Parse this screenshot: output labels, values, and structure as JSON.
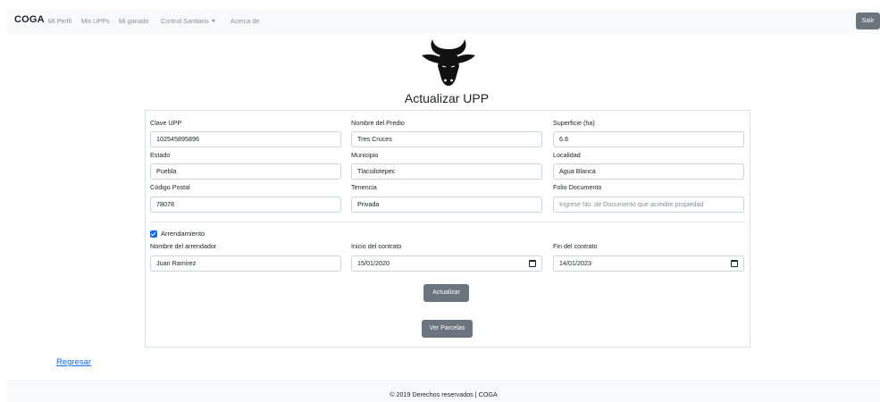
{
  "navbar": {
    "brand": "COGA",
    "links": [
      "Mi Perfil",
      "Mis UPPs",
      "Mi ganado",
      "Control Sanitario",
      "Acerca de"
    ],
    "logout_label": "Salir"
  },
  "page": {
    "title": "Actualizar UPP"
  },
  "form": {
    "clave_upp": {
      "label": "Clave UPP",
      "value": "102545895896"
    },
    "nombre_predio": {
      "label": "Nombre del Predio",
      "value": "Tres Cruces"
    },
    "superficie": {
      "label": "Superficie (ha)",
      "value": "6.8"
    },
    "estado": {
      "label": "Estado",
      "value": "Puebla"
    },
    "municipio": {
      "label": "Municipio",
      "value": "Tlacuilotepec"
    },
    "localidad": {
      "label": "Localidad",
      "value": "Agua Blanca"
    },
    "codigo_postal": {
      "label": "Código Postal",
      "value": "78078"
    },
    "tenencia": {
      "label": "Tenencia",
      "value": "Privada"
    },
    "folio_documento": {
      "label": "Folio Documento",
      "placeholder": "Ingrese No. de Documento que acredite propiedad"
    },
    "arrendamiento": {
      "label": "Arrendamiento",
      "checked": true
    },
    "nombre_arrendador": {
      "label": "Nombre del arrendador",
      "value": "Juan Ramirez"
    },
    "inicio_contrato": {
      "label": "Inicio del contrato",
      "value": "15/01/2020"
    },
    "fin_contrato": {
      "label": "Fin del contrato",
      "value": "14/01/2023"
    },
    "update_label": "Actualizar",
    "parcelas_label": "Ver Parcelas"
  },
  "back_link": "Regresar",
  "footer": {
    "text": "© 2019 Derechos reservados | COGA"
  },
  "colors": {
    "primary": "#0d6efd",
    "secondary": "#6c757d",
    "navbar_bg": "#f8f9fa"
  },
  "icons": [
    "bull-logo-icon",
    "calendar-icon",
    "caret-down-icon",
    "checkbox-checked-icon"
  ]
}
